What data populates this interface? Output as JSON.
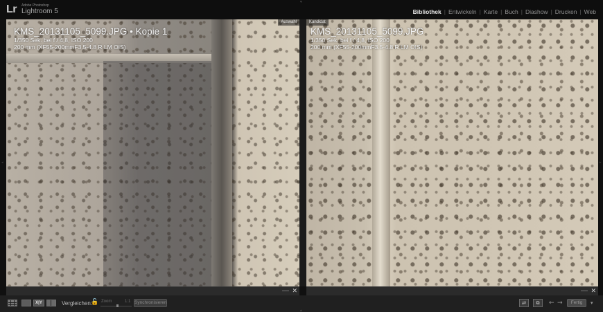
{
  "app": {
    "brand_short": "Lr",
    "brand_vendor": "Adobe Photoshop",
    "brand_name": "Lightroom 5"
  },
  "modules": [
    {
      "label": "Bibliothek",
      "active": true
    },
    {
      "label": "Entwickeln",
      "active": false
    },
    {
      "label": "Karte",
      "active": false
    },
    {
      "label": "Buch",
      "active": false
    },
    {
      "label": "Diashow",
      "active": false
    },
    {
      "label": "Drucken",
      "active": false
    },
    {
      "label": "Web",
      "active": false
    }
  ],
  "compare": {
    "left": {
      "tag": "Auswahl",
      "filename": "KMS_20131105_5099.JPG • Kopie 1",
      "exposure": "1/350 Sek. bei f / 4,8, ISO 200",
      "lens": "200 mm (XF55-200mmF3.5-4.8 R LM OIS)"
    },
    "right": {
      "tag": "Kandidat",
      "filename": "KMS_20131105_5099.JPG",
      "exposure": "1/350 Sek. bei f / 4,8, ISO 200",
      "lens": "200 mm (XF55-200mmF3.5-4.8 R LM OIS)"
    }
  },
  "toolbar": {
    "compare_label": "Vergleichen:",
    "zoom_label": "Zoom",
    "zoom_value": "1:1",
    "sync_label": "Synchronisieren",
    "done_label": "Fertig",
    "xy_label": "X|Y",
    "arrow_left": "←",
    "arrow_right": "→",
    "close_glyph": "✕",
    "lock_glyph": "🔓",
    "menu_glyph": "▾"
  },
  "colors": {
    "active_module": "#e6e6e6",
    "lock": "#c9a64a"
  }
}
